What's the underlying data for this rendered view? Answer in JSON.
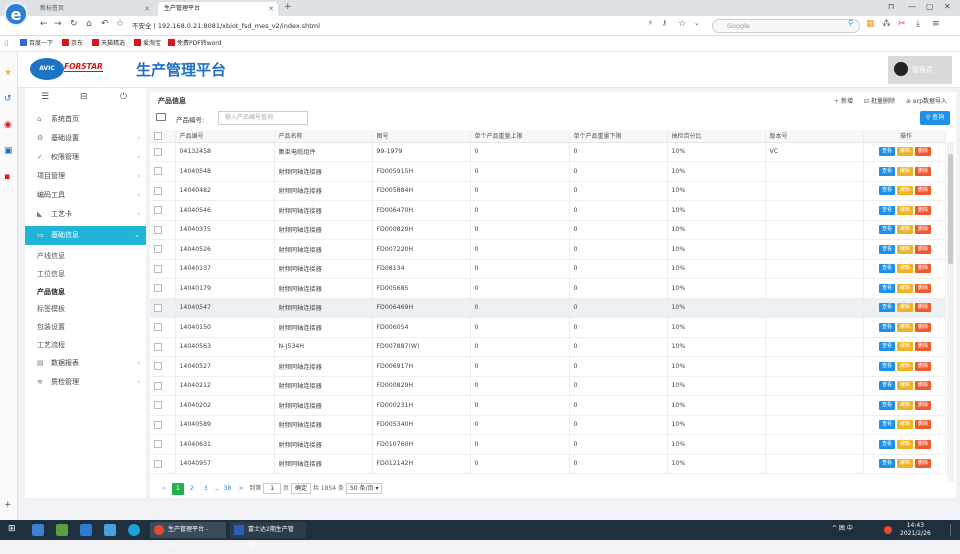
{
  "browser": {
    "logo_letter": "e",
    "tabs": [
      {
        "label": "新标签页",
        "active": false
      },
      {
        "label": "生产管理平台",
        "active": true
      }
    ],
    "new_tab": "+",
    "url": "不安全 | 192.168.0.21:8081/xbiot_fsd_mes_v2/index.shtml",
    "search_placeholder": "Google",
    "bookmarks": [
      "百度一下",
      "京东",
      "天猫精选",
      "爱淘宝",
      "免费PDF转word"
    ]
  },
  "app": {
    "logo_text": "AVIC",
    "brand": "FORSTAR",
    "title": "生产管理平台",
    "user": "管理员"
  },
  "sidebar": {
    "menu": [
      {
        "label": "系统首页",
        "icon": "home-icon",
        "glyph": "⌂",
        "chevron": false
      },
      {
        "label": "基础设置",
        "icon": "gear-icon",
        "glyph": "⚙",
        "chevron": true
      },
      {
        "label": "权限管理",
        "icon": "shield-icon",
        "glyph": "✓",
        "chevron": true
      },
      {
        "label": "项目管理",
        "icon": "",
        "glyph": "",
        "chevron": true
      },
      {
        "label": "编码工具",
        "icon": "",
        "glyph": "",
        "chevron": true
      },
      {
        "label": "工艺卡",
        "icon": "tag-icon",
        "glyph": "◣",
        "chevron": true
      },
      {
        "label": "基础信息",
        "icon": "monitor-icon",
        "glyph": "▭",
        "chevron": true,
        "open": true
      }
    ],
    "submenu": [
      "产线信息",
      "工位信息",
      "产品信息",
      "标签模板",
      "包装设置",
      "工艺流程"
    ],
    "submenu_current": "产品信息",
    "menu_after": [
      {
        "label": "数据报表",
        "icon": "table-icon",
        "glyph": "▤"
      },
      {
        "label": "质检管理",
        "icon": "layers-icon",
        "glyph": "≋"
      }
    ]
  },
  "content": {
    "page_title": "产品信息",
    "toolbar": {
      "add": "新增",
      "batch_delete": "批量删除",
      "erp_import": "erp数据导入"
    },
    "filter_label": "产品编号:",
    "filter_placeholder": "输入产品编号查询",
    "query_button": "查询",
    "columns": [
      "产品编号",
      "产品名称",
      "图号",
      "单个产品重量上限",
      "单个产品重量下限",
      "抽检百分比",
      "版本号",
      "操作"
    ],
    "actions": [
      "查看",
      "编辑",
      "删除"
    ],
    "rows": [
      [
        "04132458",
        "集束电缆组件",
        "99-1979",
        "0",
        "0",
        "10%",
        "VC"
      ],
      [
        "14040548",
        "射频同轴连接器",
        "FD005915H",
        "0",
        "0",
        "10%",
        ""
      ],
      [
        "14040482",
        "射频同轴连接器",
        "FD005884H",
        "0",
        "0",
        "10%",
        ""
      ],
      [
        "14040546",
        "射频同轴连接器",
        "FD006470H",
        "0",
        "0",
        "10%",
        ""
      ],
      [
        "14040375",
        "射频同轴连接器",
        "FD000820H",
        "0",
        "0",
        "10%",
        ""
      ],
      [
        "14040526",
        "射频同轴连接器",
        "FD007220H",
        "0",
        "0",
        "10%",
        ""
      ],
      [
        "14040137",
        "射频同轴连接器",
        "FD08134",
        "0",
        "0",
        "10%",
        ""
      ],
      [
        "14040179",
        "射频同轴连接器",
        "FD005685",
        "0",
        "0",
        "10%",
        ""
      ],
      [
        "14040547",
        "射频同轴连接器",
        "FD006469H",
        "0",
        "0",
        "10%",
        ""
      ],
      [
        "14040150",
        "射频同轴连接器",
        "FD006054",
        "0",
        "0",
        "10%",
        ""
      ],
      [
        "14040563",
        "N-J534H",
        "FD007887(W)",
        "0",
        "0",
        "10%",
        ""
      ],
      [
        "14040527",
        "射频同轴连接器",
        "FD006917H",
        "0",
        "0",
        "10%",
        ""
      ],
      [
        "14040212",
        "射频同轴连接器",
        "FD000829H",
        "0",
        "0",
        "10%",
        ""
      ],
      [
        "14040202",
        "射频同轴连接器",
        "FD000231H",
        "0",
        "0",
        "10%",
        ""
      ],
      [
        "14040589",
        "射频同轴连接器",
        "FD005340H",
        "0",
        "0",
        "10%",
        ""
      ],
      [
        "14040631",
        "射频同轴连接器",
        "FD010760H",
        "0",
        "0",
        "10%",
        ""
      ],
      [
        "14040957",
        "射频同轴连接器",
        "FD012142H",
        "0",
        "0",
        "10%",
        ""
      ]
    ],
    "highlighted_row": 8,
    "pager": {
      "prev": "<",
      "pages": [
        "1",
        "2",
        "3"
      ],
      "ellipsis": "...",
      "last": "38",
      "next": ">",
      "goto_label": "到第",
      "goto_value": "1",
      "page_unit": "页",
      "confirm": "确定",
      "total": "共 1854 条",
      "page_size": "50 条/页"
    }
  },
  "taskbar": {
    "tasks": [
      "生产管理平台 - 双...",
      "富士达2期生产管理..."
    ],
    "tray": "^ 囲 中",
    "time": "14:43",
    "date": "2021/2/26"
  }
}
